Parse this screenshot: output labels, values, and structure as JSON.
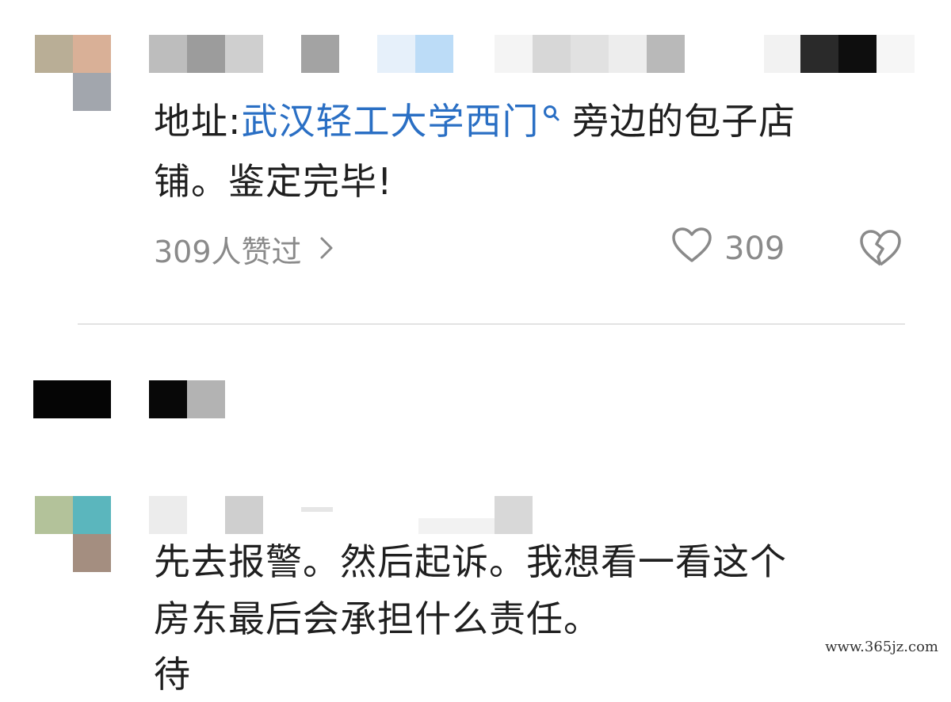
{
  "comment1": {
    "text_prefix": "地址:",
    "link_text": "武汉轻工大学西门",
    "text_suffix_line1": " 旁边的包子店",
    "text_line2": "铺。鉴定完毕!",
    "likes_summary": "309人赞过",
    "like_count": "309"
  },
  "comment2": {
    "line1": "先去报警。然后起诉。我想看一看这个",
    "line2": "房东最后会承担什么责任。",
    "line3_partial": "待"
  },
  "icons": {
    "link_search": "search-icon",
    "expand": "chevron-right-icon",
    "like": "heart-icon",
    "dislike": "broken-heart-icon"
  },
  "colors": {
    "link": "#2a6fc4",
    "meta": "#8a8a8a"
  },
  "watermark": "www.365jz.com"
}
